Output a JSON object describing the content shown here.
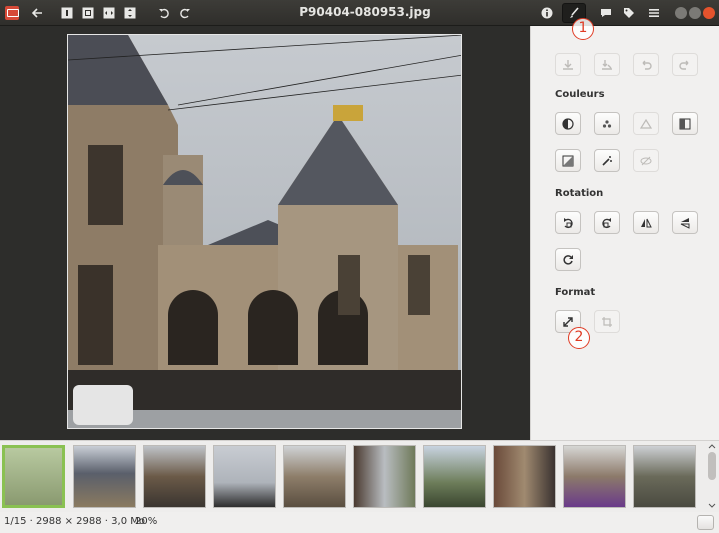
{
  "header": {
    "title": "P90404-080953.jpg",
    "buttons": [
      "back-icon",
      "zoom-1-icon",
      "zoom-fit-icon",
      "zoom-width-icon",
      "zoom-height-icon",
      "rotate-left-icon",
      "rotate-right-icon",
      "info-icon",
      "edit-icon",
      "comment-icon",
      "tag-icon",
      "menu-icon"
    ]
  },
  "badges": {
    "first": "1",
    "second": "2"
  },
  "sidebar": {
    "colors_title": "Couleurs",
    "rotation_title": "Rotation",
    "format_title": "Format"
  },
  "status": {
    "info": "1/15 · 2988 × 2988 · 3,0 Mo",
    "zoom": "20%"
  },
  "accent_color": "#8ac152",
  "badge_color": "#e03b24"
}
